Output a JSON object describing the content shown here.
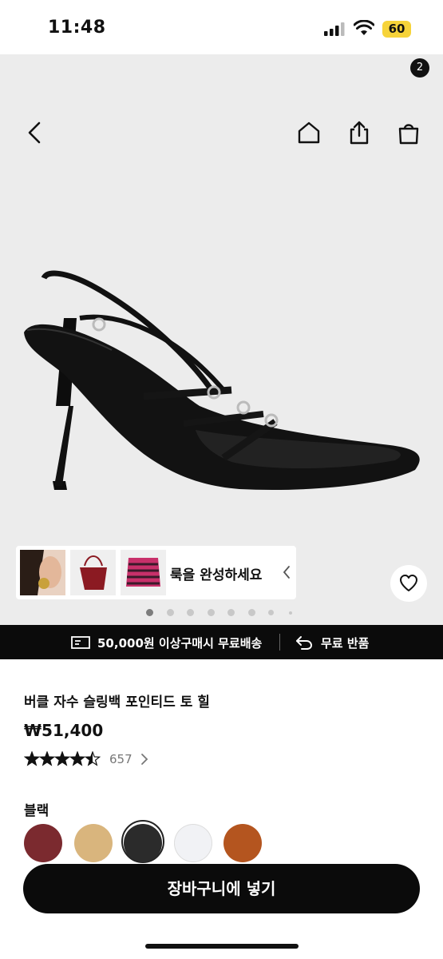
{
  "status_bar": {
    "time": "11:48",
    "battery": "60"
  },
  "header": {
    "cart_count": "2"
  },
  "look": {
    "label": "룩을 완성하세요"
  },
  "carousel": {
    "page_count": 8,
    "active_index": 0
  },
  "promo": {
    "shipping": "50,000원 이상구매시 무료배송",
    "returns": "무료 반품"
  },
  "product": {
    "title": "버클 자수 슬링백 포인티드 토 힐",
    "price": "₩51,400",
    "rating": 4.5,
    "review_count": "657"
  },
  "color": {
    "label": "블랙",
    "swatches": [
      "#7b2a2f",
      "#d9b57d",
      "#2b2b2b",
      "#f1f2f5",
      "#b4551f"
    ],
    "selected_index": 2
  },
  "actions": {
    "add_to_cart": "장바구니에 넣기"
  }
}
